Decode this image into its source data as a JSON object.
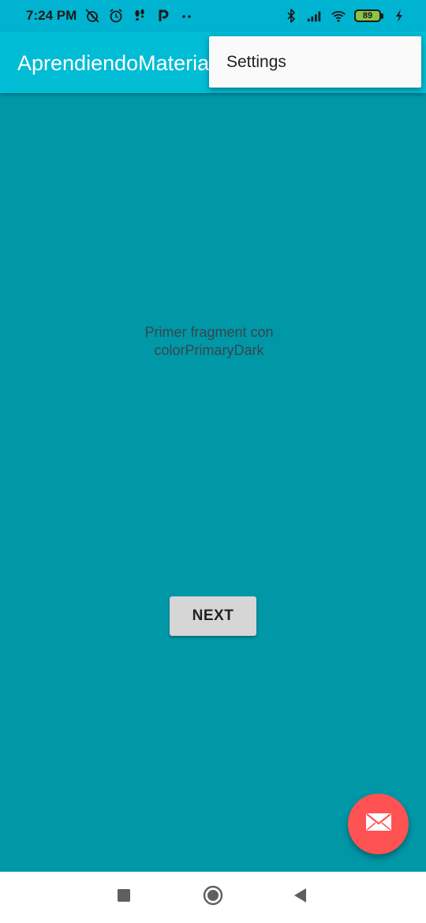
{
  "status_bar": {
    "time": "7:24 PM",
    "left_icons": [
      "alarm-off-icon",
      "alarm-icon",
      "footsteps-icon",
      "parking-p-icon",
      "more-dots-icon"
    ],
    "right_icons": [
      "bluetooth-icon",
      "signal-icon",
      "wifi-icon"
    ],
    "battery_level": "89",
    "charging": true
  },
  "app_bar": {
    "title": "AprendiendoMateria"
  },
  "overflow_menu": {
    "items": [
      {
        "label": "Settings"
      }
    ]
  },
  "content": {
    "text": "Primer fragment con colorPrimaryDark",
    "next_button_label": "NEXT"
  },
  "fab": {
    "icon": "email-icon"
  },
  "nav_bar": {
    "buttons": [
      "recents-square-icon",
      "home-circle-icon",
      "back-triangle-icon"
    ]
  },
  "colors": {
    "status_bar": "#00b3d1",
    "app_bar": "#00bcd4",
    "background": "#0097a7",
    "fab": "#ff5252",
    "button": "#d6d6d6"
  }
}
